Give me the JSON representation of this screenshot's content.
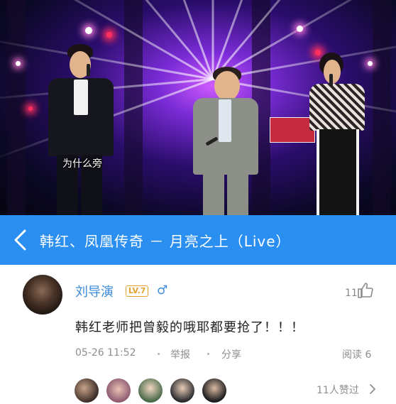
{
  "video": {
    "subtitle": "为什么旁"
  },
  "title_bar": {
    "title": "韩红、凤凰传奇 － 月亮之上（Live）",
    "back_icon": "chevron-left-icon"
  },
  "comment": {
    "username": "刘导演",
    "level": "LV.7",
    "gender": "male",
    "gender_symbol": "♂",
    "like_count": "11",
    "content": "韩红老师把曾毅的哦耶都要抢了！！！",
    "time": "05-26  11:52",
    "report_label": "举报",
    "share_label": "分享",
    "read_label": "阅读 6",
    "likers_label": "11人赞过",
    "colors": {
      "accent": "#2a8ff0",
      "username": "#3d8bd8",
      "level": "#e6a02a"
    }
  }
}
